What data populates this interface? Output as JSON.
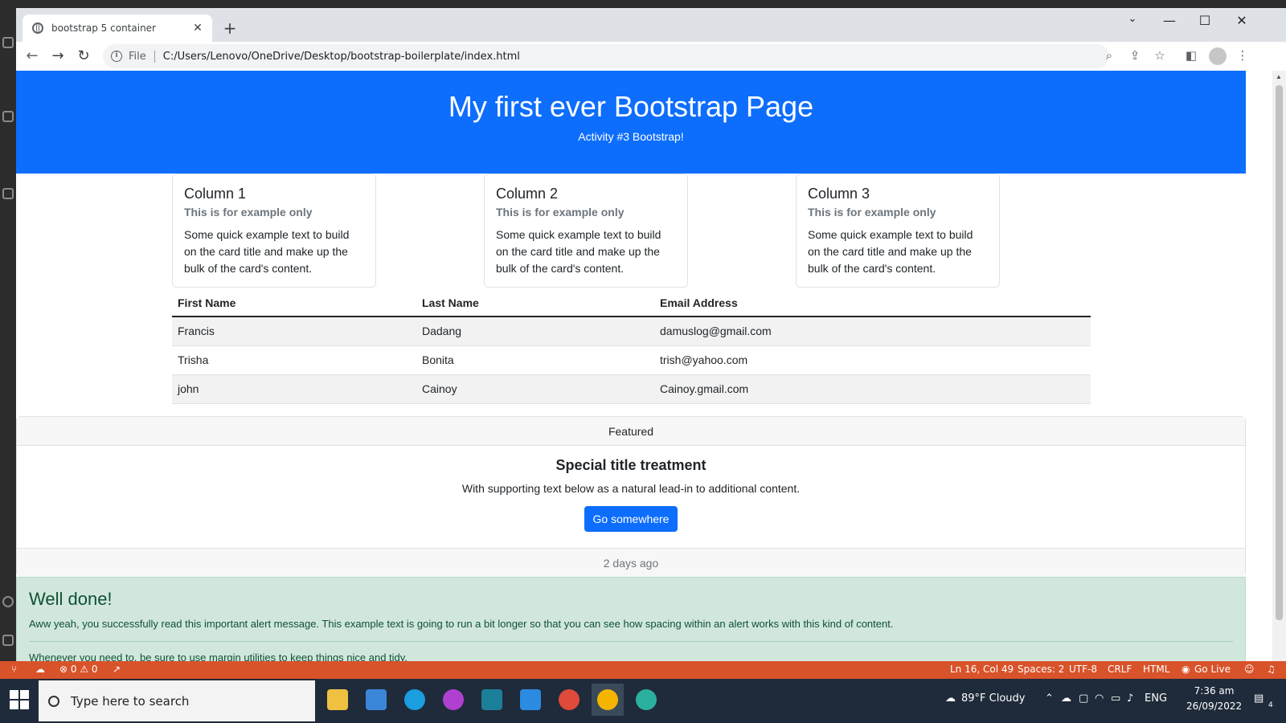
{
  "browser": {
    "tab_title": "bootstrap 5 container",
    "tab_close": "✕",
    "new_tab": "+",
    "file_label": "File",
    "url": "C:/Users/Lenovo/OneDrive/Desktop/bootstrap-boilerplate/index.html"
  },
  "hero": {
    "title": "My first ever Bootstrap Page",
    "subtitle": "Activity #3 Bootstrap!"
  },
  "cards": [
    {
      "title": "Column 1",
      "subtitle": "This is for example only",
      "text": "Some quick example text to build on the card title and make up the bulk of the card's content."
    },
    {
      "title": "Column 2",
      "subtitle": "This is for example only",
      "text": "Some quick example text to build on the card title and make up the bulk of the card's content."
    },
    {
      "title": "Column 3",
      "subtitle": "This is for example only",
      "text": "Some quick example text to build on the card title and make up the bulk of the card's content."
    }
  ],
  "table": {
    "headers": [
      "First Name",
      "Last Name",
      "Email Address"
    ],
    "rows": [
      [
        "Francis",
        "Dadang",
        "damuslog@gmail.com"
      ],
      [
        "Trisha",
        "Bonita",
        "trish@yahoo.com"
      ],
      [
        "john",
        "Cainoy",
        "Cainoy.gmail.com"
      ]
    ]
  },
  "featured": {
    "header": "Featured",
    "title": "Special title treatment",
    "text": "With supporting text below as a natural lead-in to additional content.",
    "button": "Go somewhere",
    "footer": "2 days ago"
  },
  "alert": {
    "heading": "Well done!",
    "text": "Aww yeah, you successfully read this important alert message. This example text is going to run a bit longer so that you can see how spacing within an alert works with this kind of content.",
    "more": "Whenever you need to, be sure to use margin utilities to keep things nice and tidy."
  },
  "statusbar": {
    "problems": "⊗ 0 ⚠ 0",
    "position": "Ln 16, Col 49",
    "spaces": "Spaces: 2",
    "encoding": "UTF-8",
    "eol": "CRLF",
    "language": "HTML",
    "golive": "Go Live"
  },
  "taskbar": {
    "search_placeholder": "Type here to search",
    "weather": "89°F  Cloudy",
    "lang": "ENG",
    "time": "7:36 am",
    "date": "26/09/2022",
    "notifications": "4"
  },
  "colors": {
    "primary": "#0d6efd",
    "alert_bg": "#d1e7dd",
    "alert_text": "#0f5132",
    "statusbar": "#d9532a",
    "taskbar": "#1f2b3a"
  }
}
